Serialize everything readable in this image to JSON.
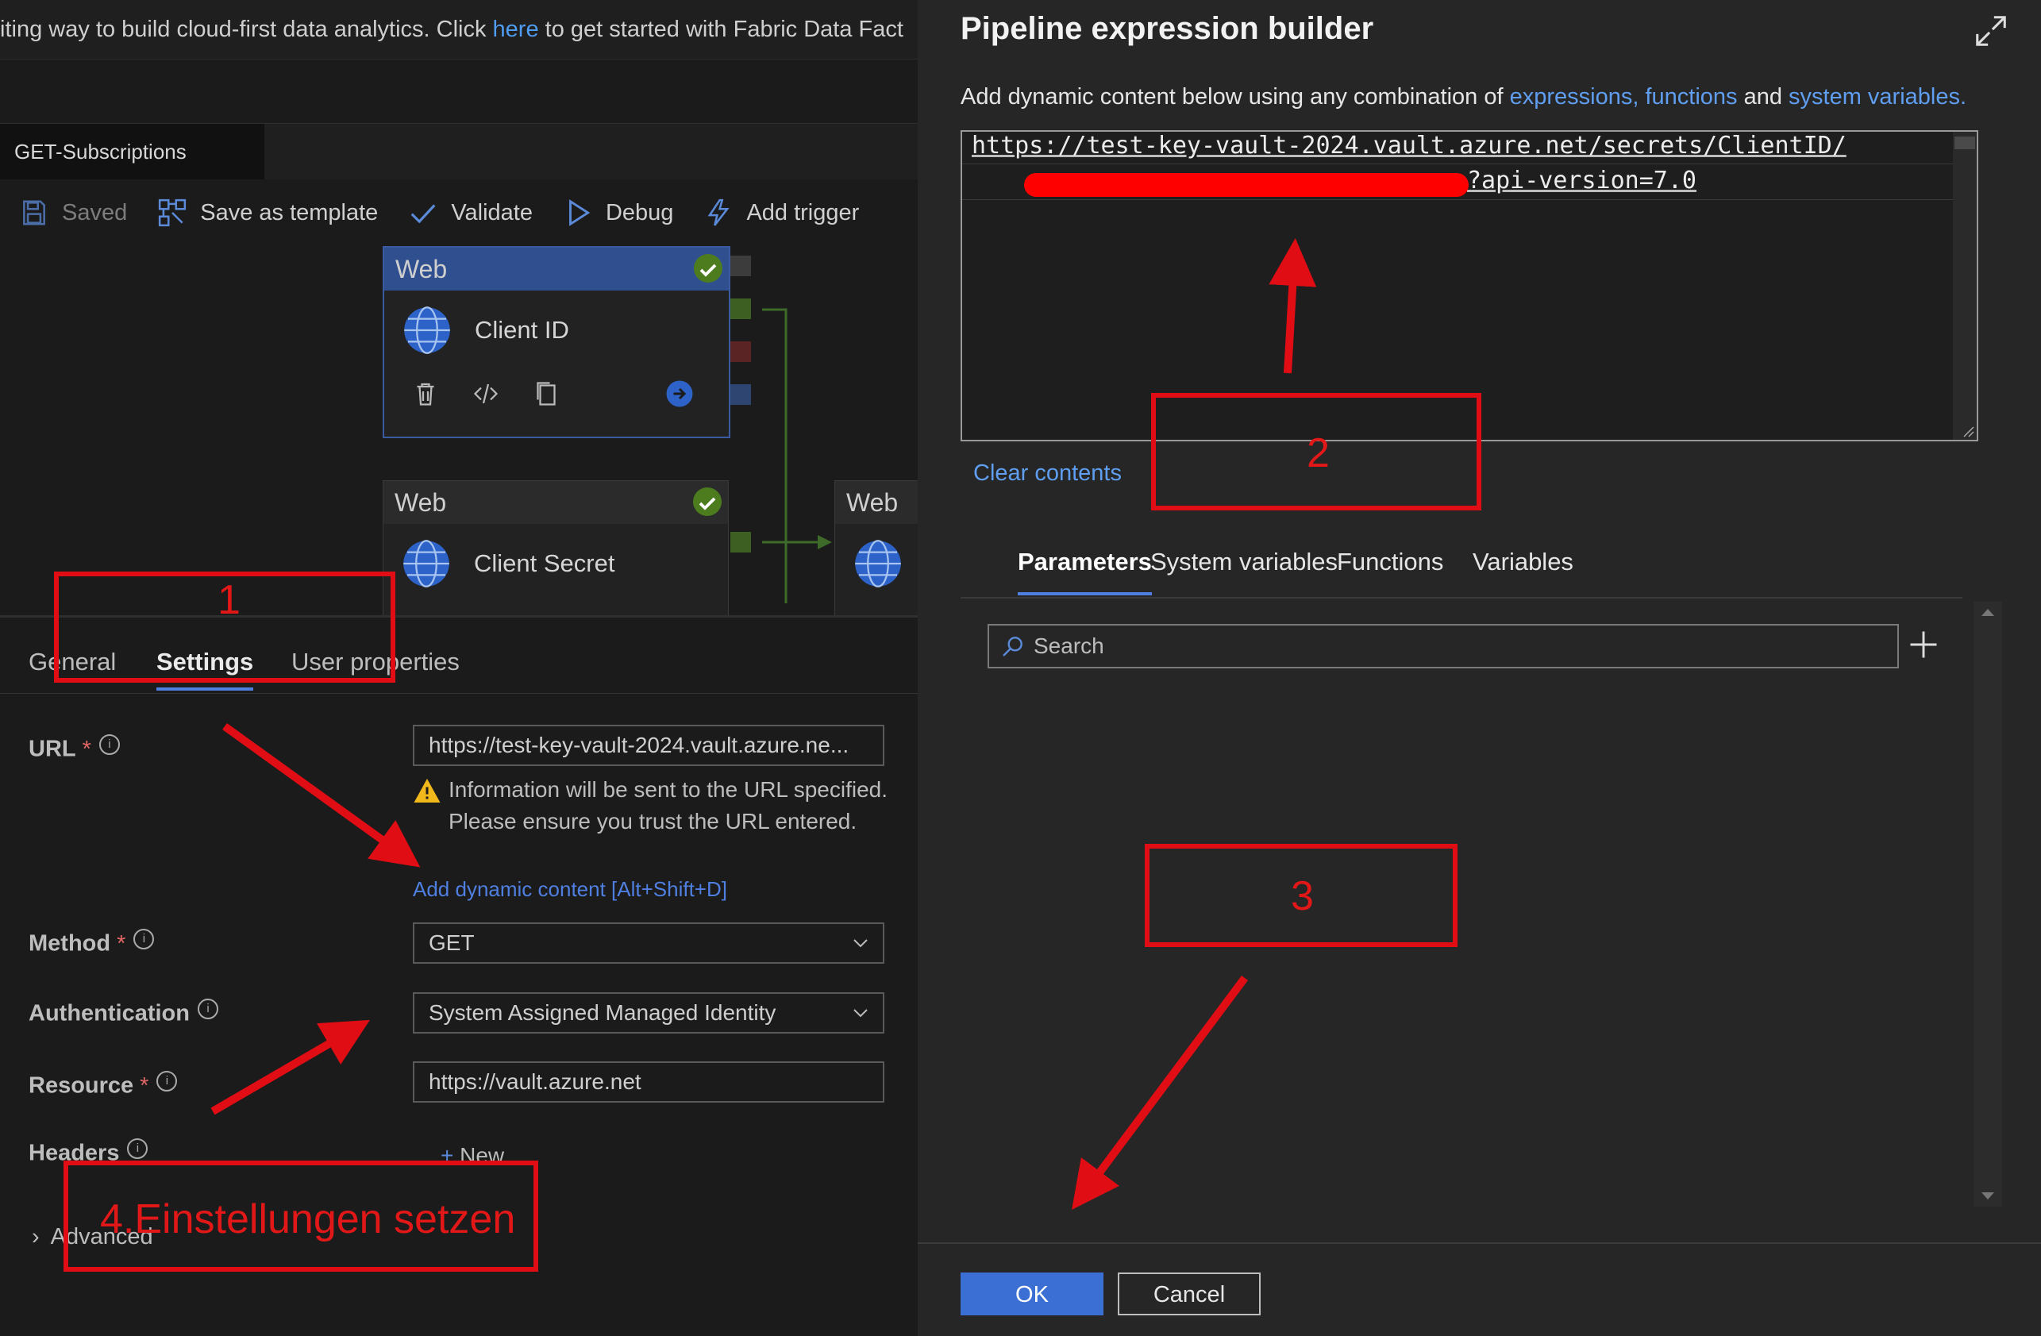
{
  "banner": {
    "text_before": "iting way to build cloud-first data analytics. Click ",
    "link": "here",
    "text_after": " to get started with Fabric Data Fact"
  },
  "pipeline_tab": "GET-Subscriptions",
  "toolbar": {
    "saved": "Saved",
    "save_as_template": "Save as template",
    "validate": "Validate",
    "debug": "Debug",
    "add_trigger": "Add trigger"
  },
  "activities": [
    {
      "type": "Web",
      "name": "Client ID"
    },
    {
      "type": "Web",
      "name": "Client Secret"
    },
    {
      "type": "Web",
      "name": ""
    }
  ],
  "prop_tabs": {
    "general": "General",
    "settings": "Settings",
    "user_properties": "User properties"
  },
  "settings": {
    "url_label": "URL",
    "url_value": "https://test-key-vault-2024.vault.azure.ne...",
    "warning": "Information will be sent to the URL specified. Please ensure you trust the URL entered.",
    "dynamic_link": "Add dynamic content [Alt+Shift+D]",
    "method_label": "Method",
    "method_value": "GET",
    "auth_label": "Authentication",
    "auth_value": "System Assigned Managed Identity",
    "resource_label": "Resource",
    "resource_value": "https://vault.azure.net",
    "headers_label": "Headers",
    "headers_new": "New",
    "advanced_label": "Advanced"
  },
  "dialog": {
    "title": "Pipeline expression builder",
    "desc_before": "Add dynamic content below using any combination of ",
    "desc_link1": "expressions, functions",
    "desc_mid": " and ",
    "desc_link2": "system variables.",
    "line1": "https://test-key-vault-2024.vault.azure.net/secrets/ClientID/",
    "line2": "?api-version=7.0",
    "clear": "Clear contents",
    "tabs": {
      "parameters": "Parameters",
      "system_variables": "System variables",
      "functions": "Functions",
      "variables": "Variables"
    },
    "search_placeholder": "Search",
    "ok": "OK",
    "cancel": "Cancel"
  },
  "annotations": {
    "one": "1",
    "two": "2",
    "three": "3",
    "four": "4.Einstellungen setzen"
  },
  "colors": {
    "accent": "#3b6fd4",
    "annotation": "#e10d14",
    "link": "#5f9ef0"
  }
}
